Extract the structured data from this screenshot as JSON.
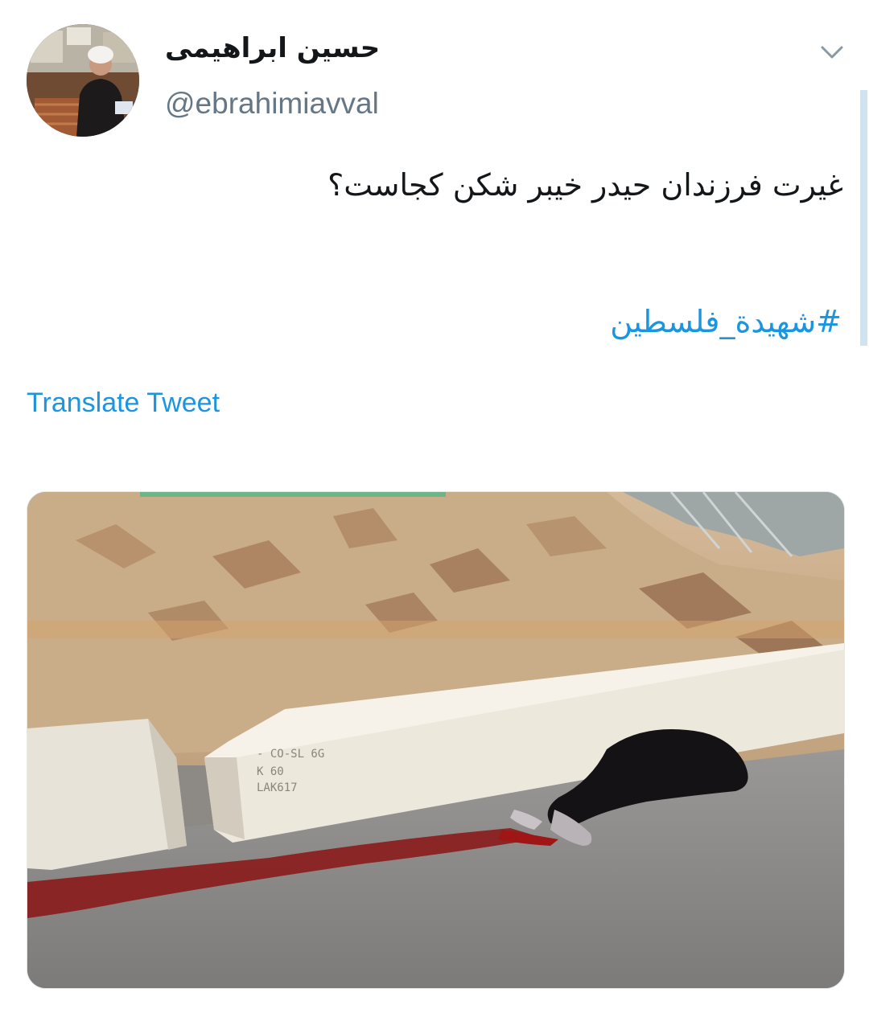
{
  "tweet": {
    "author": {
      "display_name": "حسین ابراهیمی",
      "handle": "@ebrahimiavval",
      "avatar_icon": "profile-photo"
    },
    "menu_icon": "chevron-down-icon",
    "text": "غیرت فرزندان حیدر خیبر شکن کجاست؟",
    "hashtag": "#شهیدة_فلسطین",
    "translate_label": "Translate Tweet",
    "media": {
      "type": "photo",
      "barrier_text": [
        "- CO-SL 6G",
        "K 60",
        "LAK617"
      ]
    }
  },
  "colors": {
    "text_primary": "#14171a",
    "text_secondary": "#657786",
    "link": "#1b95e0",
    "scroll_indicator": "#cfe4f2"
  }
}
